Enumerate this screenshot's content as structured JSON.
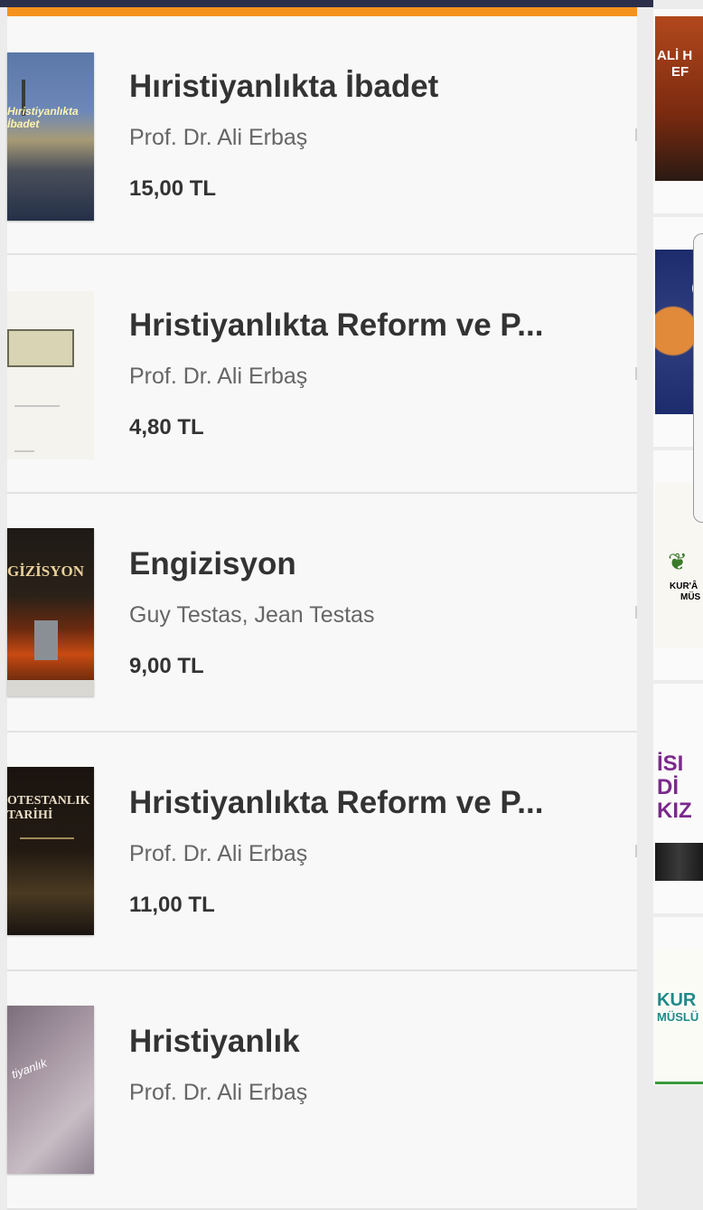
{
  "results": [
    {
      "title": "Hıristiyanlıkta İbadet",
      "author": "Prof. Dr. Ali Erbaş",
      "price": "15,00 TL",
      "cover_text": "Hıristiyanlıkta İbadet"
    },
    {
      "title": "Hristiyanlıkta Reform ve P...",
      "author": "Prof. Dr. Ali Erbaş",
      "price": "4,80 TL",
      "cover_text": ""
    },
    {
      "title": "Engizisyon",
      "author": "Guy Testas, Jean Testas",
      "price": "9,00 TL",
      "cover_text": "GİZİSYON"
    },
    {
      "title": "Hristiyanlıkta Reform ve P...",
      "author": "Prof. Dr. Ali Erbaş",
      "price": "11,00 TL",
      "cover_text": "OTESTANLIK TARİHİ"
    },
    {
      "title": "Hristiyanlık",
      "author": "Prof. Dr. Ali Erbaş",
      "price": "",
      "cover_text": "tiyanlık"
    }
  ],
  "side_covers": [
    {
      "lines": [
        "ALİ H",
        "EF"
      ],
      "color": "#ffffff"
    },
    {
      "lines": [
        "Ö"
      ],
      "color": "#ffffff"
    },
    {
      "lines": [
        "KUR'Â",
        "MÜS"
      ],
      "color": "#c59a2a"
    },
    {
      "lines": [
        "İSI",
        "Dİ",
        "KIZ"
      ],
      "color": "#7a2a8c"
    },
    {
      "lines": [
        "KUR",
        "MÜSLÜ"
      ],
      "color": "#1f8a8a"
    }
  ],
  "colors": {
    "accent": "#f5921e",
    "topbar": "#2c2f4a",
    "card_bg": "#f8f8f8"
  }
}
